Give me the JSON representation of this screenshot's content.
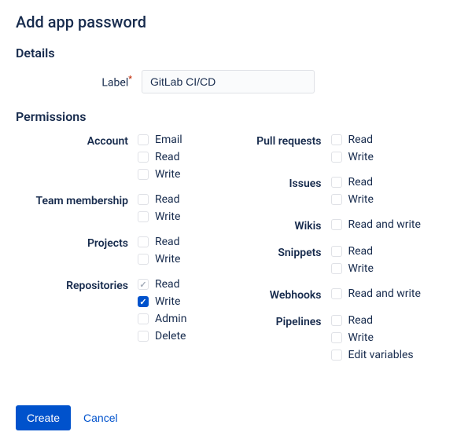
{
  "title": "Add app password",
  "sections": {
    "details": {
      "heading": "Details",
      "label_field": {
        "label": "Label",
        "value": "GitLab CI/CD"
      }
    },
    "permissions": {
      "heading": "Permissions",
      "col1": {
        "account": {
          "label": "Account",
          "opts": {
            "email": "Email",
            "read": "Read",
            "write": "Write"
          }
        },
        "team": {
          "label": "Team membership",
          "opts": {
            "read": "Read",
            "write": "Write"
          }
        },
        "projects": {
          "label": "Projects",
          "opts": {
            "read": "Read",
            "write": "Write"
          }
        },
        "repos": {
          "label": "Repositories",
          "opts": {
            "read": "Read",
            "write": "Write",
            "admin": "Admin",
            "delete": "Delete"
          }
        }
      },
      "col2": {
        "pull": {
          "label": "Pull requests",
          "opts": {
            "read": "Read",
            "write": "Write"
          }
        },
        "issues": {
          "label": "Issues",
          "opts": {
            "read": "Read",
            "write": "Write"
          }
        },
        "wikis": {
          "label": "Wikis",
          "opts": {
            "rw": "Read and write"
          }
        },
        "snippets": {
          "label": "Snippets",
          "opts": {
            "read": "Read",
            "write": "Write"
          }
        },
        "webhooks": {
          "label": "Webhooks",
          "opts": {
            "rw": "Read and write"
          }
        },
        "pipelines": {
          "label": "Pipelines",
          "opts": {
            "read": "Read",
            "write": "Write",
            "edit": "Edit variables"
          }
        }
      }
    }
  },
  "buttons": {
    "create": "Create",
    "cancel": "Cancel"
  }
}
